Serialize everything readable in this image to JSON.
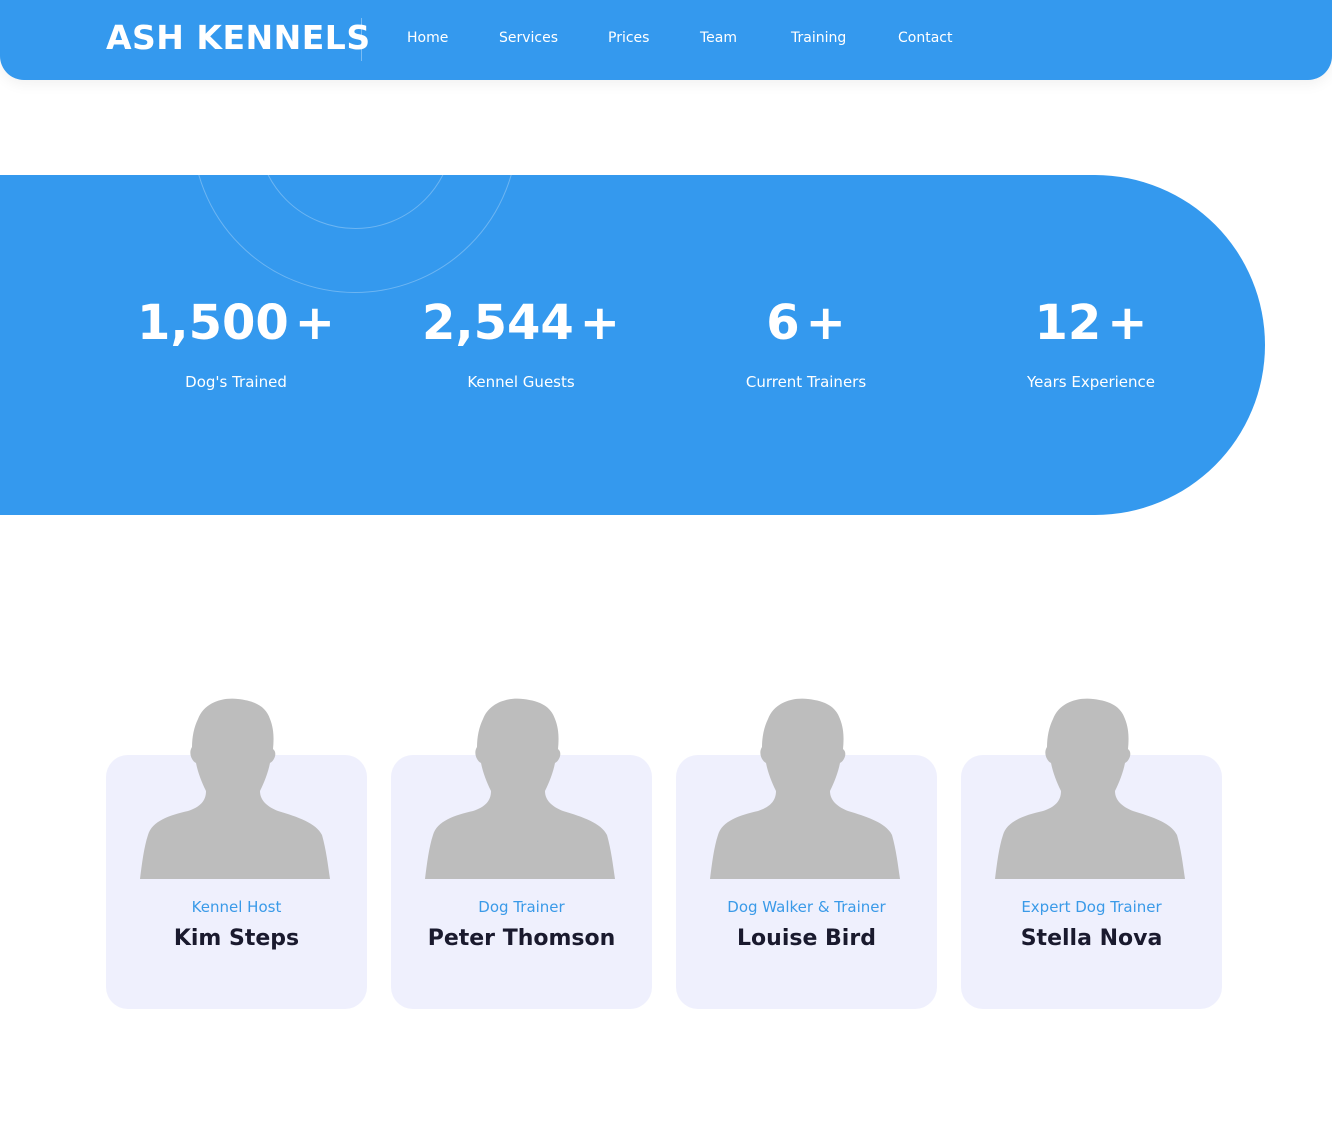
{
  "colors": {
    "primary": "#3499ee",
    "card_bg": "#eff0fd",
    "role_text": "#3a9ae8",
    "name_text": "#1a1a2e",
    "avatar": "#bdbdbd"
  },
  "header": {
    "brand": "ASH KENNELS",
    "nav": [
      "Home",
      "Services",
      "Prices",
      "Team",
      "Training",
      "Contact"
    ]
  },
  "stats": [
    {
      "number": "1,500",
      "suffix": "+",
      "label": "Dog's Trained"
    },
    {
      "number": "2,544",
      "suffix": "+",
      "label": "Kennel Guests"
    },
    {
      "number": "6",
      "suffix": "+",
      "label": "Current Trainers"
    },
    {
      "number": "12",
      "suffix": "+",
      "label": "Years Experience"
    }
  ],
  "team": [
    {
      "role": "Kennel Host",
      "name": "Kim Steps",
      "avatar_icon": "person-silhouette-icon"
    },
    {
      "role": "Dog Trainer",
      "name": "Peter Thomson",
      "avatar_icon": "person-silhouette-icon"
    },
    {
      "role": "Dog Walker & Trainer",
      "name": "Louise Bird",
      "avatar_icon": "person-silhouette-icon"
    },
    {
      "role": "Expert Dog Trainer",
      "name": "Stella Nova",
      "avatar_icon": "person-silhouette-icon"
    }
  ]
}
